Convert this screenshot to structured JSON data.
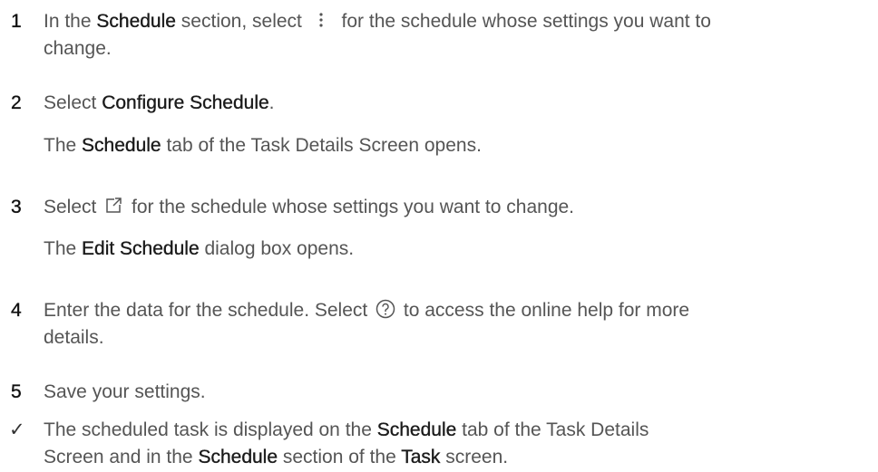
{
  "steps": [
    {
      "number": "1",
      "parts": {
        "a": "In the ",
        "b": "Schedule",
        "c": " section, select ",
        "icon": "more-vert-icon",
        "d": " for the schedule whose settings you want to",
        "e": "change."
      }
    },
    {
      "number": "2",
      "parts": {
        "a": "Select ",
        "b": "Configure Schedule",
        "c": "."
      },
      "result": {
        "a": "The ",
        "b": "Schedule",
        "c": " tab of the Task Details Screen opens."
      }
    },
    {
      "number": "3",
      "parts": {
        "a": "Select ",
        "icon": "edit-icon",
        "b": " for the schedule whose settings you want to change."
      },
      "result": {
        "a": "The ",
        "b": "Edit Schedule",
        "c": " dialog box opens."
      }
    },
    {
      "number": "4",
      "parts": {
        "a": "Enter the data for the schedule. Select ",
        "icon": "help-icon",
        "b": " to access the online help for more",
        "c": "details."
      }
    },
    {
      "number": "5",
      "parts": {
        "a": "Save your settings."
      }
    }
  ],
  "outcome": {
    "icon": "check-icon",
    "symbol": "✓",
    "a": "The scheduled task is displayed on the ",
    "b": "Schedule",
    "c": " tab of the Task Details",
    "d": "Screen and in the ",
    "e": "Schedule",
    "f": " section of the ",
    "g": "Task",
    "h": " screen."
  }
}
